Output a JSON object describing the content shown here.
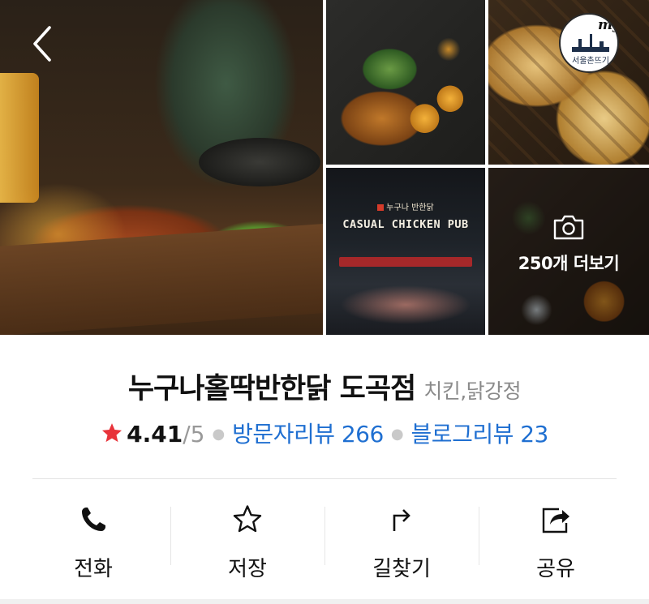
{
  "gallery": {
    "pub_sign": "CASUAL CHICKEN PUB",
    "pub_logo": "누구나 반한닭",
    "more_photos_label": "250개 더보기",
    "watermark_text": "my",
    "watermark_caption": "서울촌뜨기"
  },
  "store": {
    "name": "누구나홀딱반한닭 도곡점",
    "category": "치킨,닭강정"
  },
  "rating": {
    "value": "4.41",
    "max": "/5",
    "visitor_reviews": "방문자리뷰 266",
    "blog_reviews": "블로그리뷰 23"
  },
  "actions": {
    "call": "전화",
    "save": "저장",
    "directions": "길찾기",
    "share": "공유"
  },
  "colors": {
    "accent_link": "#1f6fd1",
    "star": "#e8333a",
    "category_text": "#8a8a8a"
  },
  "icons": [
    "back-arrow-icon",
    "camera-icon",
    "star-icon",
    "phone-icon",
    "star-outline-icon",
    "directions-icon",
    "share-icon"
  ]
}
